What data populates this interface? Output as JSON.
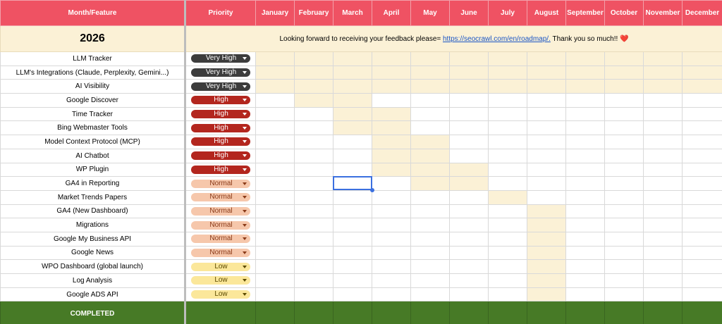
{
  "header": {
    "feature_col": "Month/Feature",
    "priority_col": "Priority",
    "months": [
      "January",
      "February",
      "March",
      "April",
      "May",
      "June",
      "July",
      "August",
      "September",
      "October",
      "November",
      "December"
    ]
  },
  "year": "2026",
  "feedback": {
    "before": "Looking forward to receiving your feedback please= ",
    "link": "https://seocrawl.com/en/roadmap/.",
    "after": " Thank you so much!! ",
    "heart": "❤️"
  },
  "priority_colors": {
    "Very High": "#3c3c3c",
    "High": "#b3261e",
    "Normal": "#f6c7ab",
    "Low": "#fbe79a"
  },
  "timeline_color": "#fbf1d6",
  "rows": [
    {
      "feature": "LLM Tracker",
      "priority": "Very High",
      "months": [
        2,
        3,
        4,
        5,
        6,
        7,
        8,
        9,
        10,
        11,
        12,
        13
      ]
    },
    {
      "feature": "LLM's Integrations (Claude, Perplexity, Gemini...)",
      "priority": "Very High",
      "months": [
        2,
        3,
        4,
        5,
        6,
        7,
        8,
        9,
        10,
        11,
        12,
        13
      ]
    },
    {
      "feature": "AI Visibility",
      "priority": "Very High",
      "months": [
        2,
        3,
        4,
        5,
        6,
        7,
        8,
        9,
        10,
        11,
        12,
        13
      ]
    },
    {
      "feature": "Google Discover",
      "priority": "High",
      "months": [
        3,
        4
      ]
    },
    {
      "feature": "Time Tracker",
      "priority": "High",
      "months": [
        4,
        5
      ]
    },
    {
      "feature": "Bing Webmaster Tools",
      "priority": "High",
      "months": [
        4,
        5
      ]
    },
    {
      "feature": "Model Context Protocol (MCP)",
      "priority": "High",
      "months": [
        5,
        6
      ]
    },
    {
      "feature": "AI Chatbot",
      "priority": "High",
      "months": [
        5,
        6
      ]
    },
    {
      "feature": "WP Plugin",
      "priority": "High",
      "months": [
        5,
        6,
        7
      ]
    },
    {
      "feature": "GA4 in Reporting",
      "priority": "Normal",
      "months": [
        6,
        7
      ]
    },
    {
      "feature": "Market Trends Papers",
      "priority": "Normal",
      "months": [
        8
      ]
    },
    {
      "feature": "GA4 (New Dashboard)",
      "priority": "Normal",
      "months": [
        9
      ]
    },
    {
      "feature": "Migrations",
      "priority": "Normal",
      "months": [
        9
      ]
    },
    {
      "feature": "Google My Business API",
      "priority": "Normal",
      "months": [
        9
      ]
    },
    {
      "feature": "Google News",
      "priority": "Normal",
      "months": [
        9
      ]
    },
    {
      "feature": "WPO Dashboard (global launch)",
      "priority": "Low",
      "months": [
        9
      ]
    },
    {
      "feature": "Log Analysis",
      "priority": "Low",
      "months": [
        9
      ]
    },
    {
      "feature": "Google ADS API",
      "priority": "Low",
      "months": [
        9
      ]
    }
  ],
  "completed_label": "COMPLETED"
}
